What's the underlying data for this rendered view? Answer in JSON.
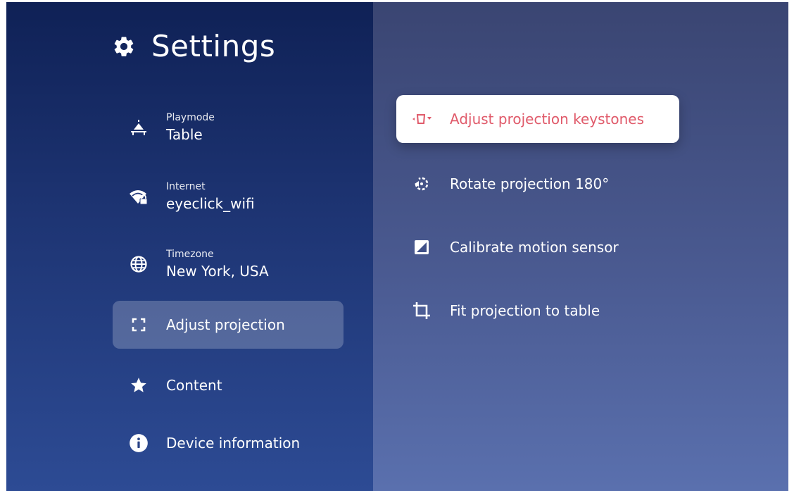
{
  "header": {
    "title": "Settings"
  },
  "sidebar": {
    "items": [
      {
        "label": "Playmode",
        "value": "Table"
      },
      {
        "label": "Internet",
        "value": "eyeclick_wifi"
      },
      {
        "label": "Timezone",
        "value": "New York, USA"
      },
      {
        "label": "Adjust projection"
      },
      {
        "label": "Content"
      },
      {
        "label": "Device information"
      }
    ]
  },
  "options": [
    {
      "label": "Adjust projection keystones"
    },
    {
      "label": "Rotate projection 180°"
    },
    {
      "label": "Calibrate motion sensor"
    },
    {
      "label": "Fit projection to table"
    }
  ],
  "colors": {
    "accent": "#e05a6a"
  },
  "icons": {
    "title": "gear-icon",
    "sidebar": [
      "table-icon",
      "wifi-lock-icon",
      "globe-icon",
      "fullscreen-icon",
      "star-icon",
      "info-icon"
    ],
    "options": [
      "keystone-icon",
      "rotate-icon",
      "motion-sensor-icon",
      "crop-icon"
    ]
  }
}
